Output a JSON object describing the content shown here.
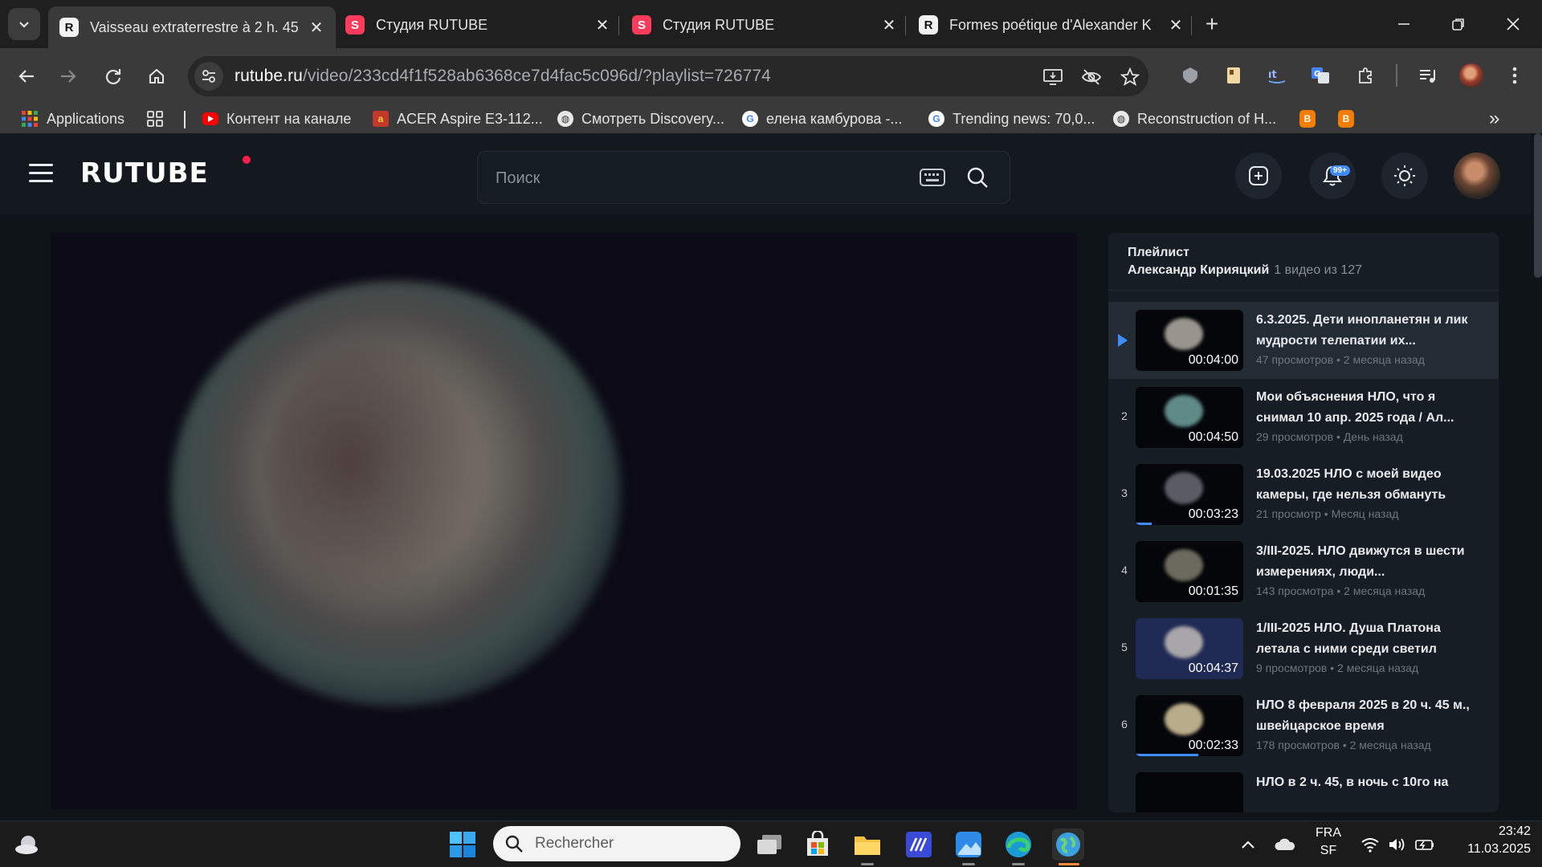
{
  "browser": {
    "tabs": [
      {
        "title": "Vaisseau extraterrestre à 2 h. 45",
        "favicon": "R",
        "active": true
      },
      {
        "title": "Студия RUTUBE",
        "favicon": "S",
        "active": false
      },
      {
        "title": "Студия RUTUBE",
        "favicon": "S",
        "active": false
      },
      {
        "title": "Formes poétique d'Alexander K",
        "favicon": "R",
        "active": false
      }
    ],
    "close_glyph": "✕",
    "new_tab_glyph": "+",
    "url_host": "rutube.ru",
    "url_path": "/video/233cd4f1f528ab6368ce7d4fac5c096d/?playlist=726774",
    "bookmarks": [
      {
        "label": "Applications",
        "icon": "apps-grid-icon"
      },
      {
        "label": "Контент на канале",
        "icon": "youtube-icon"
      },
      {
        "label": "ACER Aspire E3-112...",
        "icon": "acer-icon"
      },
      {
        "label": "Смотреть Discovery...",
        "icon": "globe-icon"
      },
      {
        "label": "елена камбурова -...",
        "icon": "google-icon"
      },
      {
        "label": "Trending news: 70,0...",
        "icon": "google-icon"
      },
      {
        "label": "Reconstruction of H...",
        "icon": "globe-icon"
      }
    ],
    "more_bookmarks": "»"
  },
  "rutube": {
    "logo": "RUTUBE",
    "search_placeholder": "Поиск",
    "notifications_badge": "99+",
    "playlist": {
      "label": "Плейлист",
      "author": "Александр Кирияцкий",
      "count": "1 видео из 127",
      "items": [
        {
          "index": "",
          "title": "6.3.2025. Дети инопланетян и лик мудрости телепатии их...",
          "duration": "00:04:00",
          "meta": "47 просмотров • 2 месяца назад",
          "current": true,
          "watched": 0
        },
        {
          "index": "2",
          "title": "Мои объяснения НЛО, что я снимал 10 апр. 2025 года / Ал...",
          "duration": "00:04:50",
          "meta": "29 просмотров • День назад",
          "current": false,
          "watched": 0
        },
        {
          "index": "3",
          "title": "19.03.2025 НЛО с моей видео камеры, где нельзя обмануть",
          "duration": "00:03:23",
          "meta": "21 просмотр • Месяц назад",
          "current": false,
          "watched": 0.15
        },
        {
          "index": "4",
          "title": "3/III-2025. НЛО движутся в шести измерениях, люди...",
          "duration": "00:01:35",
          "meta": "143 просмотра • 2 месяца назад",
          "current": false,
          "watched": 0
        },
        {
          "index": "5",
          "title": "1/III-2025 НЛО. Душа Платона летала с ними среди светил",
          "duration": "00:04:37",
          "meta": "9 просмотров • 2 месяца назад",
          "current": false,
          "watched": 0
        },
        {
          "index": "6",
          "title": "НЛО 8 февраля 2025 в 20 ч. 45 м., швейцарское время",
          "duration": "00:02:33",
          "meta": "178 просмотров • 2 месяца назад",
          "current": false,
          "watched": 0.58
        },
        {
          "index": "",
          "title": "НЛО в 2 ч. 45, в ночь с 10го на",
          "duration": "",
          "meta": "",
          "current": false,
          "watched": 0
        }
      ]
    }
  },
  "taskbar": {
    "search_placeholder": "Rechercher",
    "lang_top": "FRA",
    "lang_bottom": "SF",
    "time": "23:42",
    "date": "11.03.2025"
  }
}
